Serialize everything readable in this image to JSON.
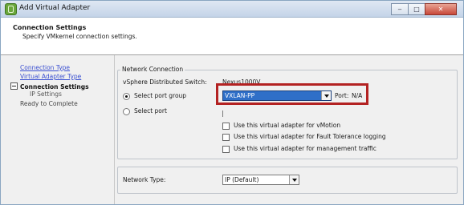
{
  "window": {
    "title": "Add Virtual Adapter",
    "controls": {
      "minimize": "‒",
      "maximize": "□",
      "close": "✕"
    }
  },
  "header": {
    "title": "Connection Settings",
    "subtitle": "Specify VMkernel connection settings."
  },
  "steps": [
    {
      "label": "Connection Type"
    },
    {
      "label": "Virtual Adapter Type"
    },
    {
      "label": "Connection Settings"
    },
    {
      "label": "IP Settings"
    },
    {
      "label": "Ready to Complete"
    }
  ],
  "network_connection": {
    "legend": "Network Connection",
    "switch_label": "vSphere Distributed Switch:",
    "switch_value": "Nexus1000V",
    "port_group_label": "Select port group",
    "port_group_value": "VXLAN-PP",
    "port_label": "Port:",
    "port_value": "N/A",
    "select_port_label": "Select port",
    "checkboxes": [
      {
        "label": "Use this virtual adapter for vMotion",
        "checked": false
      },
      {
        "label": "Use this virtual adapter for Fault Tolerance logging",
        "checked": false
      },
      {
        "label": "Use this virtual adapter for management traffic",
        "checked": false
      }
    ]
  },
  "network_type": {
    "label": "Network Type:",
    "value": "IP (Default)"
  }
}
